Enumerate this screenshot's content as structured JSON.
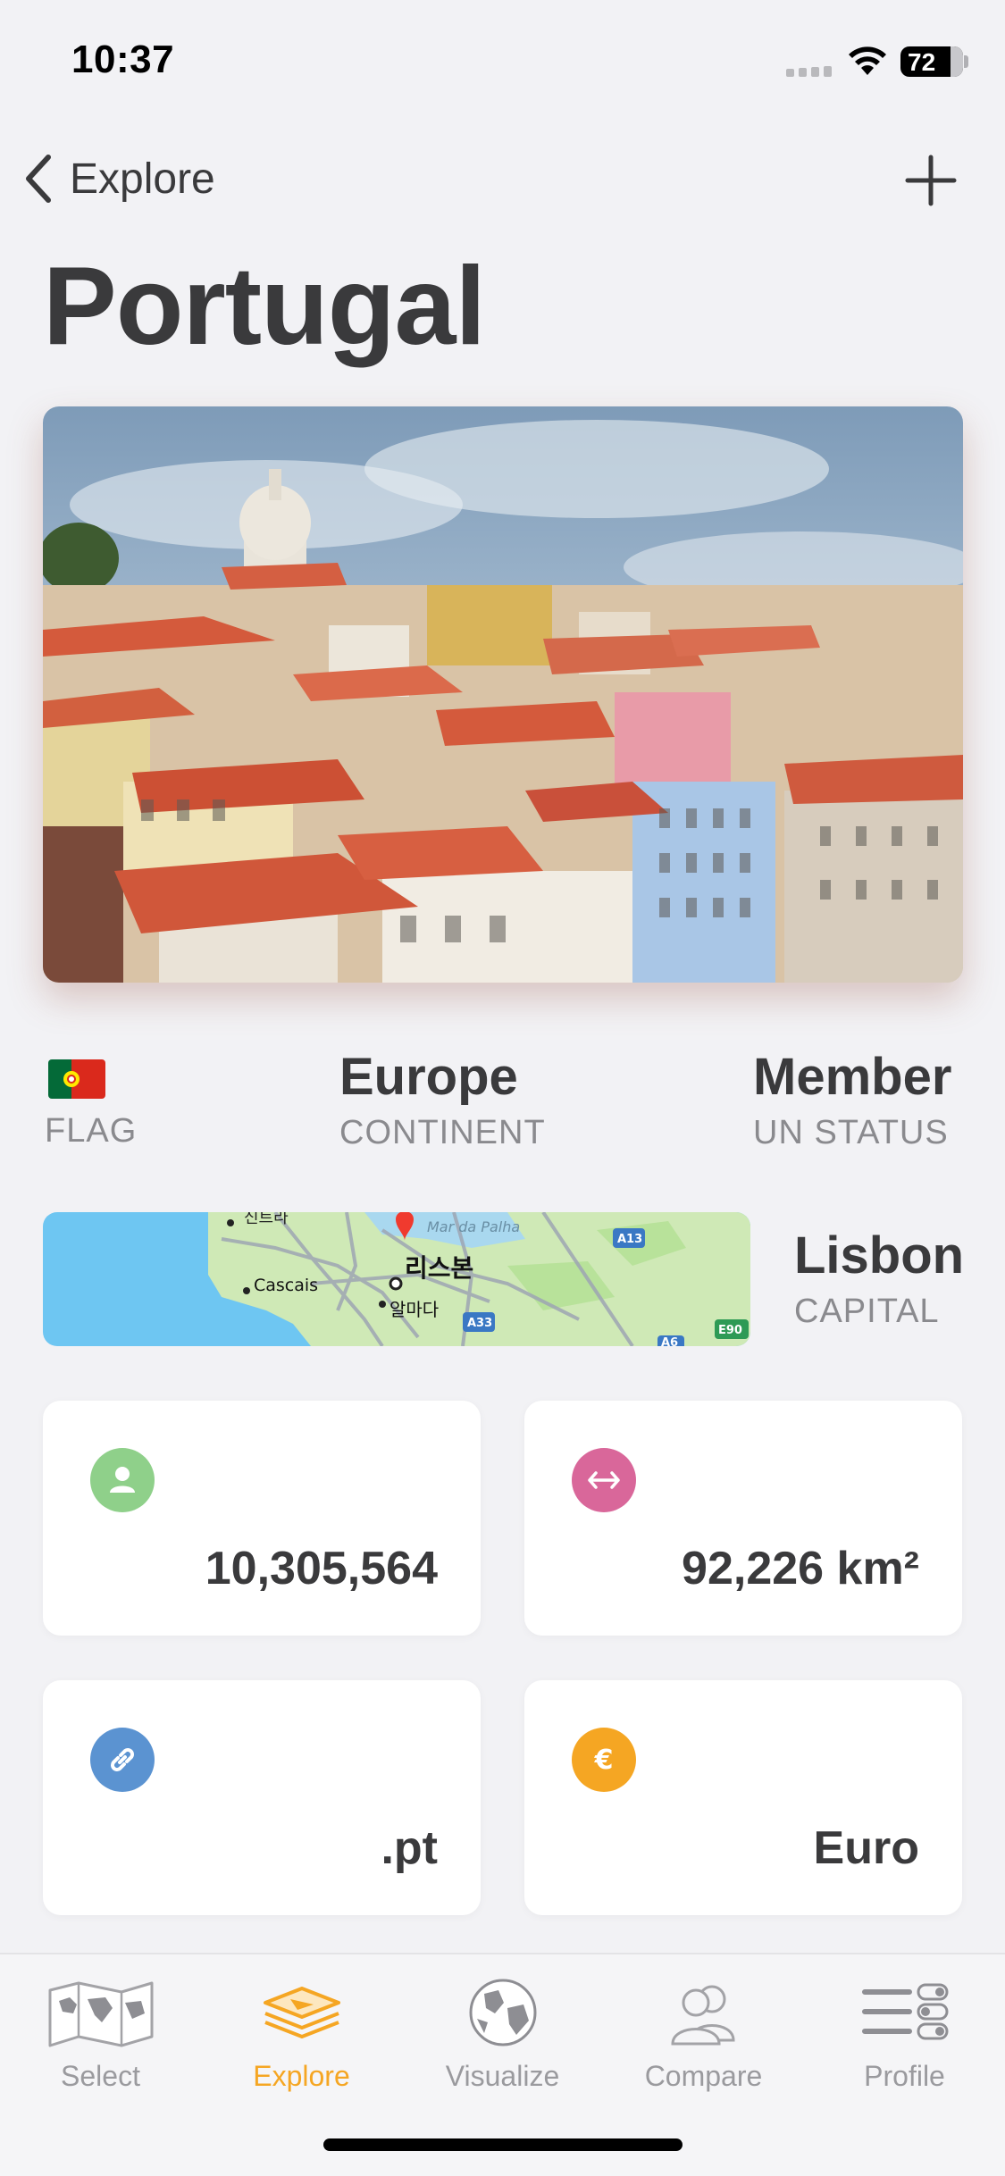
{
  "status_bar": {
    "time": "10:37",
    "battery": "72",
    "battery_level": 0.72
  },
  "nav": {
    "back_label": "Explore",
    "add_icon": "plus-icon"
  },
  "page": {
    "title": "Portugal"
  },
  "hero": {
    "description_icon": "photo"
  },
  "info": {
    "flag_caption": "FLAG",
    "continent_value": "Europe",
    "continent_caption": "CONTINENT",
    "un_status_value": "Member",
    "un_status_caption": "UN STATUS",
    "capital_value": "Lisbon",
    "capital_caption": "CAPITAL"
  },
  "map": {
    "labels": [
      "신트라",
      "Mar da Palha",
      "리스본",
      "Cascais",
      "알마다"
    ],
    "road_labels": [
      "A13",
      "A33",
      "A6",
      "E90"
    ]
  },
  "cards": [
    {
      "icon": "person-icon",
      "color": "#8fd08a",
      "value": "10,305,564"
    },
    {
      "icon": "arrows-horizontal-icon",
      "color": "#d9679a",
      "value": "92,226 km²"
    },
    {
      "icon": "link-icon",
      "color": "#5b93d1",
      "value": ".pt"
    },
    {
      "icon": "euro-icon",
      "color": "#f5a623",
      "value": "Euro"
    }
  ],
  "tabs": [
    {
      "label": "Select",
      "icon": "world-map-icon",
      "active": false
    },
    {
      "label": "Explore",
      "icon": "layers-icon",
      "active": true
    },
    {
      "label": "Visualize",
      "icon": "globe-icon",
      "active": false
    },
    {
      "label": "Compare",
      "icon": "people-icon",
      "active": false
    },
    {
      "label": "Profile",
      "icon": "list-toggle-icon",
      "active": false
    }
  ],
  "colors": {
    "accent": "#f5a623",
    "background": "#f2f2f5",
    "text": "#3a3a3c",
    "secondary_text": "#8a8a8e"
  }
}
